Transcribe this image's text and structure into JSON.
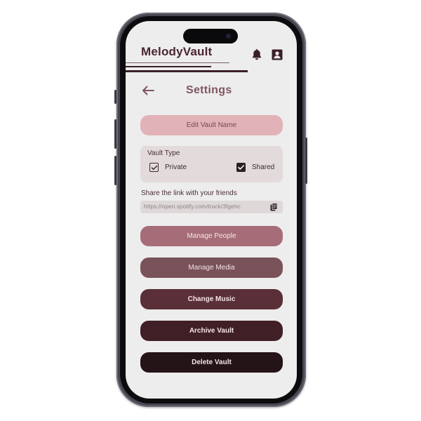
{
  "app": {
    "brand": "MelodyVault",
    "icons": {
      "notifications": "bell-icon",
      "profile": "account-icon",
      "back": "arrow-left-icon",
      "copy": "copy-icon"
    }
  },
  "page": {
    "title": "Settings"
  },
  "actions": {
    "edit_vault_name": "Edit Vault Name",
    "manage_people": "Manage People",
    "manage_media": "Manage Media",
    "change_music": "Change Music",
    "archive_vault": "Archive Vault",
    "delete_vault": "Delete Vault"
  },
  "vault_type": {
    "label": "Vault Type",
    "options": [
      {
        "label": "Private",
        "checked": true
      },
      {
        "label": "Shared",
        "checked": true
      }
    ]
  },
  "share": {
    "label": "Share the link with your friends",
    "link": "https://open.spotify.com/track/3fgehc"
  },
  "colors": {
    "brand": "#4a2630",
    "title": "#7e5660",
    "edit_button": "#e1b3b8",
    "people_button": "#a66d78",
    "media_button": "#7a5259",
    "music_button": "#5a2f37",
    "archive_button": "#401f26",
    "delete_button": "#241317"
  }
}
